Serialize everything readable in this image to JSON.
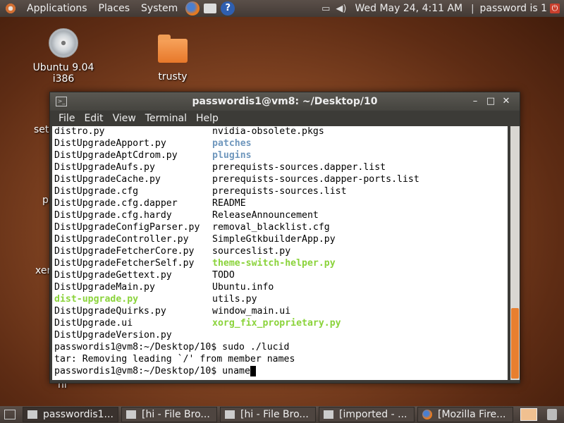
{
  "top_panel": {
    "menus": [
      "Applications",
      "Places",
      "System"
    ],
    "clock": "Wed May 24,  4:11 AM",
    "user": "password is 1"
  },
  "desktop": {
    "icons": [
      {
        "label": "Ubuntu 9.04 i386"
      },
      {
        "label": "trusty"
      }
    ],
    "edge_labels": [
      "set",
      "p",
      "xer",
      "nl"
    ]
  },
  "terminal": {
    "title": "passwordis1@vm8: ~/Desktop/10",
    "menu": [
      "File",
      "Edit",
      "View",
      "Terminal",
      "Help"
    ],
    "listing": [
      [
        {
          "t": "distro.py",
          "c": ""
        },
        {
          "t": "nvidia-obsolete.pkgs",
          "c": ""
        }
      ],
      [
        {
          "t": "DistUpgradeApport.py",
          "c": ""
        },
        {
          "t": "patches",
          "c": "blue"
        }
      ],
      [
        {
          "t": "DistUpgradeAptCdrom.py",
          "c": ""
        },
        {
          "t": "plugins",
          "c": "blue"
        }
      ],
      [
        {
          "t": "DistUpgradeAufs.py",
          "c": ""
        },
        {
          "t": "prerequists-sources.dapper.list",
          "c": ""
        }
      ],
      [
        {
          "t": "DistUpgradeCache.py",
          "c": ""
        },
        {
          "t": "prerequists-sources.dapper-ports.list",
          "c": ""
        }
      ],
      [
        {
          "t": "DistUpgrade.cfg",
          "c": ""
        },
        {
          "t": "prerequists-sources.list",
          "c": ""
        }
      ],
      [
        {
          "t": "DistUpgrade.cfg.dapper",
          "c": ""
        },
        {
          "t": "README",
          "c": ""
        }
      ],
      [
        {
          "t": "DistUpgrade.cfg.hardy",
          "c": ""
        },
        {
          "t": "ReleaseAnnouncement",
          "c": ""
        }
      ],
      [
        {
          "t": "DistUpgradeConfigParser.py",
          "c": ""
        },
        {
          "t": "removal_blacklist.cfg",
          "c": ""
        }
      ],
      [
        {
          "t": "DistUpgradeController.py",
          "c": ""
        },
        {
          "t": "SimpleGtkbuilderApp.py",
          "c": ""
        }
      ],
      [
        {
          "t": "DistUpgradeFetcherCore.py",
          "c": ""
        },
        {
          "t": "sourceslist.py",
          "c": ""
        }
      ],
      [
        {
          "t": "DistUpgradeFetcherSelf.py",
          "c": ""
        },
        {
          "t": "theme-switch-helper.py",
          "c": "green"
        }
      ],
      [
        {
          "t": "DistUpgradeGettext.py",
          "c": ""
        },
        {
          "t": "TODO",
          "c": ""
        }
      ],
      [
        {
          "t": "DistUpgradeMain.py",
          "c": ""
        },
        {
          "t": "Ubuntu.info",
          "c": ""
        }
      ],
      [
        {
          "t": "dist-upgrade.py",
          "c": "green"
        },
        {
          "t": "utils.py",
          "c": ""
        }
      ],
      [
        {
          "t": "DistUpgradeQuirks.py",
          "c": ""
        },
        {
          "t": "window_main.ui",
          "c": ""
        }
      ],
      [
        {
          "t": "DistUpgrade.ui",
          "c": ""
        },
        {
          "t": "xorg_fix_proprietary.py",
          "c": "green"
        }
      ],
      [
        {
          "t": "DistUpgradeVersion.py",
          "c": ""
        },
        {
          "t": "",
          "c": ""
        }
      ]
    ],
    "after": [
      "passwordis1@vm8:~/Desktop/10$ sudo ./lucid",
      "tar: Removing leading `/' from member names"
    ],
    "prompt": "passwordis1@vm8:~/Desktop/10$ uname"
  },
  "taskbar": {
    "tasks": [
      {
        "label": "passwordis1...",
        "icon": "terminal-icon"
      },
      {
        "label": "[hi - File Bro...",
        "icon": "folder-icon"
      },
      {
        "label": "[hi - File Bro...",
        "icon": "folder-icon"
      },
      {
        "label": "[imported - ...",
        "icon": "folder-icon"
      },
      {
        "label": "[Mozilla Fire...",
        "icon": "firefox-icon"
      }
    ]
  }
}
